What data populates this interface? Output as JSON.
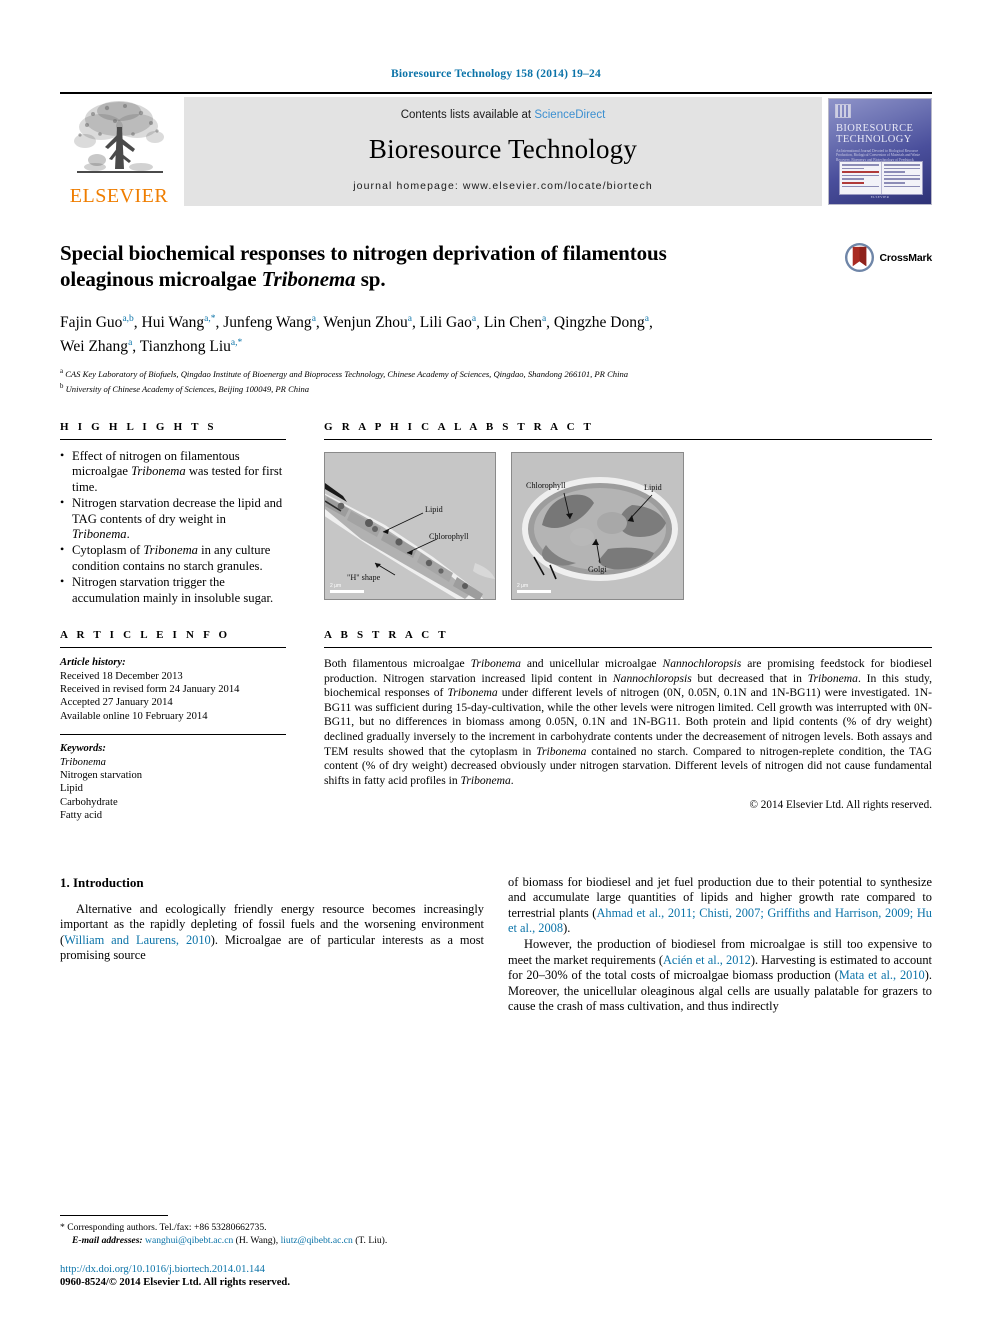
{
  "running_head": "Bioresource Technology 158 (2014) 19–24",
  "masthead": {
    "contents_prefix": "Contents lists available at ",
    "sciencedirect": "ScienceDirect",
    "journal_name": "Bioresource Technology",
    "homepage": "journal homepage: www.elsevier.com/locate/biortech",
    "publisher": "ELSEVIER",
    "cover": {
      "title_line1": "BIORESOURCE",
      "title_line2": "TECHNOLOGY",
      "subtitle": "An International Journal Devoted to Biological Resource Production, Biological Conversion of Materials and Waste Recovery, Bioenergy and Biotechnology of Feedstock",
      "footer": "ELSEVIER"
    }
  },
  "article": {
    "title_line1": "Special biochemical responses to nitrogen deprivation of filamentous",
    "title_line2_pre": "oleaginous microalgae ",
    "title_line2_italic": "Tribonema",
    "title_line2_post": " sp.",
    "crossmark_label": "CrossMark",
    "authors_line1": "Fajin Guo a,b, Hui Wang a,*, Junfeng Wang a, Wenjun Zhou a, Lili Gao a, Lin Chen a, Qingzhe Dong a,",
    "authors_line2": "Wei Zhang a, Tianzhong Liu a,*",
    "authors": [
      {
        "name": "Fajin Guo",
        "sup": "a,b"
      },
      {
        "name": "Hui Wang",
        "sup": "a,*"
      },
      {
        "name": "Junfeng Wang",
        "sup": "a"
      },
      {
        "name": "Wenjun Zhou",
        "sup": "a"
      },
      {
        "name": "Lili Gao",
        "sup": "a"
      },
      {
        "name": "Lin Chen",
        "sup": "a"
      },
      {
        "name": "Qingzhe Dong",
        "sup": "a"
      },
      {
        "name": "Wei Zhang",
        "sup": "a"
      },
      {
        "name": "Tianzhong Liu",
        "sup": "a,*"
      }
    ],
    "affiliation_a": "CAS Key Laboratory of Biofuels, Qingdao Institute of Bioenergy and Bioprocess Technology, Chinese Academy of Sciences, Qingdao, Shandong 266101, PR China",
    "affiliation_b": "University of Chinese Academy of Sciences, Beijing 100049, PR China"
  },
  "highlights": {
    "heading": "H I G H L I G H T S",
    "items": [
      {
        "pre": "Effect of nitrogen on filamentous microalgae ",
        "italic": "Tribonema",
        "post": " was tested for first time."
      },
      {
        "pre": "Nitrogen starvation decrease the lipid and TAG contents of dry weight in ",
        "italic": "Tribonema",
        "post": "."
      },
      {
        "pre": "Cytoplasm of ",
        "italic": "Tribonema",
        "post": " in any culture condition contains no starch granules."
      },
      {
        "pre": "Nitrogen starvation trigger the accumulation mainly in insoluble sugar.",
        "italic": "",
        "post": ""
      }
    ]
  },
  "graphical_abstract": {
    "heading": "G R A P H I C A L   A B S T R A C T",
    "image_left": {
      "labels": [
        "Lipid",
        "Chlorophyll",
        "\"H\" shape"
      ],
      "scale": "2 μm"
    },
    "image_right": {
      "labels": [
        "Chlorophyll",
        "Lipid",
        "Golgi"
      ],
      "scale": "2 μm"
    }
  },
  "article_info": {
    "heading": "A R T I C L E   I N F O",
    "history_label": "Article history:",
    "history": [
      "Received 18 December 2013",
      "Received in revised form 24 January 2014",
      "Accepted 27 January 2014",
      "Available online 10 February 2014"
    ],
    "keywords_label": "Keywords:",
    "keywords": [
      "Tribonema",
      "Nitrogen starvation",
      "Lipid",
      "Carbohydrate",
      "Fatty acid"
    ]
  },
  "abstract": {
    "heading": "A B S T R A C T",
    "p1_a": "Both filamentous microalgae ",
    "p1_i1": "Tribonema",
    "p1_b": " and unicellular microalgae ",
    "p1_i2": "Nannochloropsis",
    "p1_c": " are promising feedstock for biodiesel production. Nitrogen starvation increased lipid content in ",
    "p1_i3": "Nannochloropsis",
    "p1_d": " but decreased that in ",
    "p1_i4": "Tribonema",
    "p1_e": ". In this study, biochemical responses of ",
    "p1_i5": "Tribonema",
    "p1_f": " under different levels of nitrogen (0N, 0.05N, 0.1N and 1N-BG11) were investigated. 1N-BG11 was sufficient during 15-day-cultivation, while the other levels were nitrogen limited. Cell growth was interrupted with 0N-BG11, but no differences in biomass among 0.05N, 0.1N and 1N-BG11. Both protein and lipid contents (% of dry weight) declined gradually inversely to the increment in carbohydrate contents under the decreasement of nitrogen levels. Both assays and TEM results showed that the cytoplasm in ",
    "p1_i6": "Tribonema",
    "p1_g": " contained no starch. Compared to nitrogen-replete condition, the TAG content (% of dry weight) decreased obviously under nitrogen starvation. Different levels of nitrogen did not cause fundamental shifts in fatty acid profiles in ",
    "p1_i7": "Tribonema",
    "p1_h": ".",
    "copyright": "© 2014 Elsevier Ltd. All rights reserved."
  },
  "body": {
    "section_title": "1. Introduction",
    "left_p1_a": "Alternative and ecologically friendly energy resource becomes increasingly important as the rapidly depleting of fossil fuels and the worsening environment (",
    "left_p1_ref": "William and Laurens, 2010",
    "left_p1_b": "). Microalgae are of particular interests as a most promising source",
    "right_p1_a": "of biomass for biodiesel and jet fuel production due to their potential to synthesize and accumulate large quantities of lipids and higher growth rate compared to terrestrial plants (",
    "right_p1_ref": "Ahmad et al., 2011; Chisti, 2007; Griffiths and Harrison, 2009; Hu et al., 2008",
    "right_p1_b": ").",
    "right_p2_a": "However, the production of biodiesel from microalgae is still too expensive to meet the market requirements (",
    "right_p2_ref1": "Acién et al., 2012",
    "right_p2_b": "). Harvesting is estimated to account for 20–30% of the total costs of microalgae biomass production (",
    "right_p2_ref2": "Mata et al., 2010",
    "right_p2_c": "). Moreover, the unicellular oleaginous algal cells are usually palatable for grazers to cause the crash of mass cultivation, and thus indirectly"
  },
  "footer": {
    "corresponding_marker": "*",
    "corresponding": "Corresponding authors. Tel./fax: +86 53280662735.",
    "email_label": "E-mail addresses:",
    "email1": "wanghui@qibebt.ac.cn",
    "email1_owner": "(H. Wang),",
    "email2": "liutz@qibebt.ac.cn",
    "email2_owner": "(T. Liu).",
    "doi": "http://dx.doi.org/10.1016/j.biortech.2014.01.144",
    "issn": "0960-8524/© 2014 Elsevier Ltd. All rights reserved."
  },
  "colors": {
    "link_blue": "#0b73a8",
    "sciencedirect_blue": "#3b8fd0",
    "elsevier_orange": "#ef7d00",
    "crossmark_red": "#a92b22"
  }
}
